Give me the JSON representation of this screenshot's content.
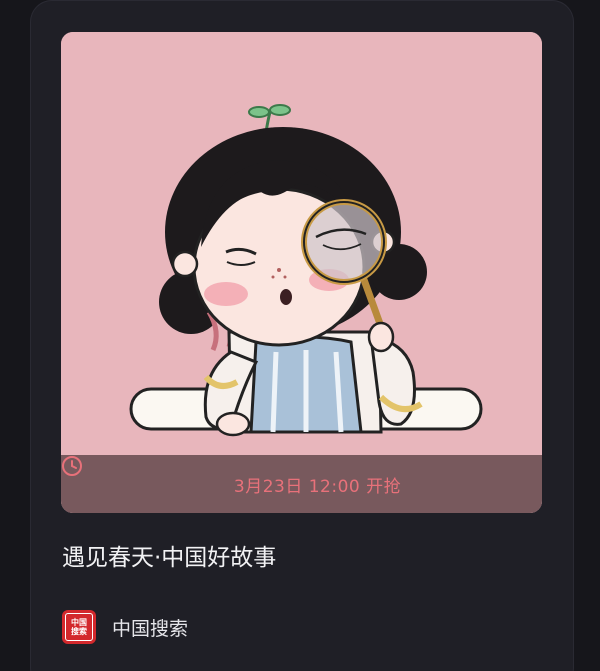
{
  "card": {
    "cover": {
      "image": "illustration of a girl with a sprout on her head holding a magnifying glass",
      "background_color": "#e8b6bc",
      "time_icon": "clock-icon",
      "time_text": "3月23日 12:00 开抢",
      "accent_color": "#e8717a"
    },
    "title": "遇见春天·中国好故事",
    "author": {
      "logo_icon": "china-search-logo-icon",
      "logo_text_line1": "中国",
      "logo_text_line2": "搜索",
      "name": "中国搜索",
      "brand_color": "#d3282c"
    }
  }
}
